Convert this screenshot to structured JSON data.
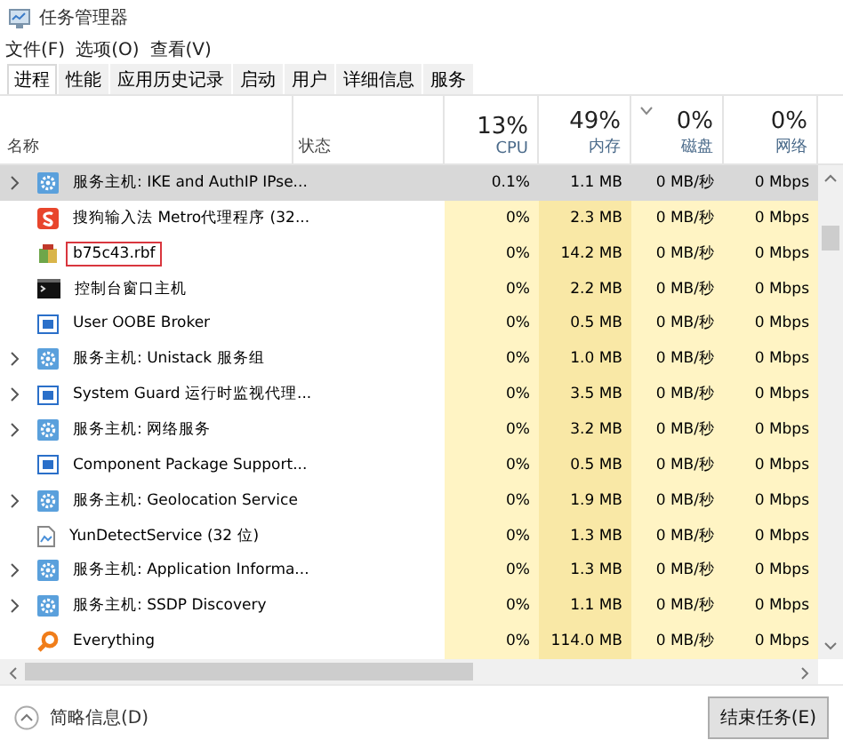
{
  "window": {
    "title": "任务管理器"
  },
  "menu": [
    "文件(F)",
    "选项(O)",
    "查看(V)"
  ],
  "tabs": [
    {
      "label": "进程",
      "selected": true
    },
    {
      "label": "性能",
      "selected": false
    },
    {
      "label": "应用历史记录",
      "selected": false
    },
    {
      "label": "启动",
      "selected": false
    },
    {
      "label": "用户",
      "selected": false
    },
    {
      "label": "详细信息",
      "selected": false
    },
    {
      "label": "服务",
      "selected": false
    }
  ],
  "columns": {
    "name": "名称",
    "status": "状态",
    "metrics": [
      {
        "percent": "13%",
        "label": "CPU",
        "sorted": false
      },
      {
        "percent": "49%",
        "label": "内存",
        "sorted": false
      },
      {
        "percent": "0%",
        "label": "磁盘",
        "sorted": true
      },
      {
        "percent": "0%",
        "label": "网络",
        "sorted": false
      }
    ]
  },
  "rows": [
    {
      "kind": "gear",
      "name": "服务主机: IKE and AuthIP IPse...",
      "expandable": true,
      "selected": true,
      "highlighted": false,
      "cpu": "0.1%",
      "memory": "1.1 MB",
      "disk": "0 MB/秒",
      "network": "0 Mbps"
    },
    {
      "kind": "sogou",
      "name": "搜狗输入法 Metro代理程序 (32...",
      "expandable": false,
      "selected": false,
      "highlighted": false,
      "cpu": "0%",
      "memory": "2.3 MB",
      "disk": "0 MB/秒",
      "network": "0 Mbps"
    },
    {
      "kind": "package",
      "name": "b75c43.rbf",
      "expandable": false,
      "selected": false,
      "highlighted": true,
      "cpu": "0%",
      "memory": "14.2 MB",
      "disk": "0 MB/秒",
      "network": "0 Mbps"
    },
    {
      "kind": "console",
      "name": "控制台窗口主机",
      "expandable": false,
      "selected": false,
      "highlighted": false,
      "cpu": "0%",
      "memory": "2.2 MB",
      "disk": "0 MB/秒",
      "network": "0 Mbps"
    },
    {
      "kind": "window",
      "name": "User OOBE Broker",
      "expandable": false,
      "selected": false,
      "highlighted": false,
      "cpu": "0%",
      "memory": "0.5 MB",
      "disk": "0 MB/秒",
      "network": "0 Mbps"
    },
    {
      "kind": "gear",
      "name": "服务主机: Unistack 服务组",
      "expandable": true,
      "selected": false,
      "highlighted": false,
      "cpu": "0%",
      "memory": "1.0 MB",
      "disk": "0 MB/秒",
      "network": "0 Mbps"
    },
    {
      "kind": "window",
      "name": "System Guard 运行时监视代理...",
      "expandable": true,
      "selected": false,
      "highlighted": false,
      "cpu": "0%",
      "memory": "3.5 MB",
      "disk": "0 MB/秒",
      "network": "0 Mbps"
    },
    {
      "kind": "gear",
      "name": "服务主机: 网络服务",
      "expandable": true,
      "selected": false,
      "highlighted": false,
      "cpu": "0%",
      "memory": "3.2 MB",
      "disk": "0 MB/秒",
      "network": "0 Mbps"
    },
    {
      "kind": "window",
      "name": "Component Package Support...",
      "expandable": false,
      "selected": false,
      "highlighted": false,
      "cpu": "0%",
      "memory": "0.5 MB",
      "disk": "0 MB/秒",
      "network": "0 Mbps"
    },
    {
      "kind": "gear",
      "name": "服务主机: Geolocation Service",
      "expandable": true,
      "selected": false,
      "highlighted": false,
      "cpu": "0%",
      "memory": "1.9 MB",
      "disk": "0 MB/秒",
      "network": "0 Mbps"
    },
    {
      "kind": "document",
      "name": "YunDetectService (32 位)",
      "expandable": false,
      "selected": false,
      "highlighted": false,
      "cpu": "0%",
      "memory": "1.3 MB",
      "disk": "0 MB/秒",
      "network": "0 Mbps"
    },
    {
      "kind": "gear",
      "name": "服务主机: Application Informa...",
      "expandable": true,
      "selected": false,
      "highlighted": false,
      "cpu": "0%",
      "memory": "1.3 MB",
      "disk": "0 MB/秒",
      "network": "0 Mbps"
    },
    {
      "kind": "gear",
      "name": "服务主机: SSDP Discovery",
      "expandable": true,
      "selected": false,
      "highlighted": false,
      "cpu": "0%",
      "memory": "1.1 MB",
      "disk": "0 MB/秒",
      "network": "0 Mbps"
    },
    {
      "kind": "search",
      "name": "Everything",
      "expandable": false,
      "selected": false,
      "highlighted": false,
      "cpu": "0%",
      "memory": "114.0 MB",
      "disk": "0 MB/秒",
      "network": "0 Mbps"
    }
  ],
  "footer": {
    "details": "简略信息(D)",
    "end_task": "结束任务(E)"
  }
}
